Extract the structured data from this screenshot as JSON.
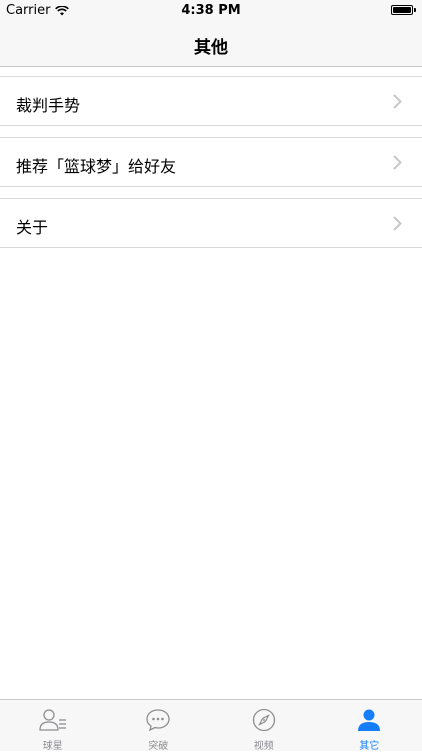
{
  "status_bar": {
    "carrier": "Carrier",
    "time": "4:38 PM"
  },
  "nav": {
    "title": "其他"
  },
  "menu": {
    "items": [
      {
        "label": "裁判手势"
      },
      {
        "label": "推荐「篮球梦」给好友"
      },
      {
        "label": "关于"
      }
    ]
  },
  "tab_bar": {
    "active_color": "#157efb",
    "inactive_color": "#8e8e93",
    "tabs": [
      {
        "label": "球星",
        "icon": "contacts-icon",
        "active": false
      },
      {
        "label": "突破",
        "icon": "chat-bubble-icon",
        "active": false
      },
      {
        "label": "视频",
        "icon": "compass-icon",
        "active": false
      },
      {
        "label": "其它",
        "icon": "person-icon",
        "active": true
      }
    ]
  }
}
